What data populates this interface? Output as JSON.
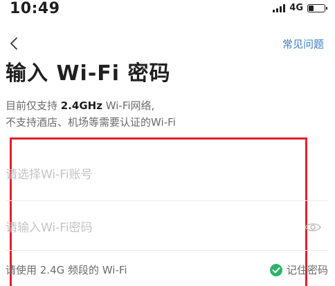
{
  "status_bar": {
    "time": "10:49",
    "network": "4G",
    "battery_level": 0.3
  },
  "nav": {
    "back_icon": "chevron-left-icon",
    "help_link": "常见问题"
  },
  "title": "输入 Wi-Fi 密码",
  "description": {
    "line1_prefix": "目前仅支持",
    "line1_freq": "2.4GHz",
    "line1_suffix": "Wi-Fi网络,",
    "line2": "不支持酒店、机场等需要认证的Wi-Fi"
  },
  "form": {
    "ssid_placeholder": "请选择Wi-Fi账号",
    "password_placeholder": "请输入Wi-Fi密码",
    "password_toggle_icon": "eye-icon",
    "band_hint": "请使用 2.4G 频段的 Wi-Fi",
    "remember_label": "记住密码",
    "remember_checked": true
  },
  "colors": {
    "accent_link": "#3a7fc4",
    "check_green": "#2fb36b",
    "highlight_outline": "#e0202a"
  }
}
